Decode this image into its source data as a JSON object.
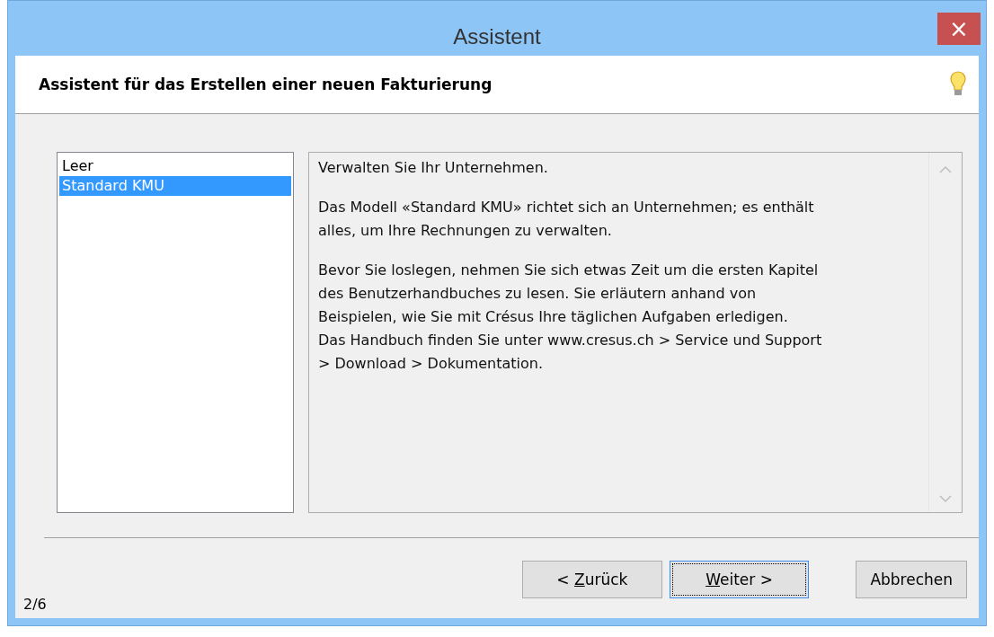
{
  "window": {
    "title": "Assistent",
    "close": "×"
  },
  "header": {
    "title": "Assistent für das Erstellen einer neuen Fakturierung"
  },
  "models": [
    {
      "label": "Leer",
      "selected": false
    },
    {
      "label": "Standard KMU",
      "selected": true
    }
  ],
  "description": [
    "Verwalten Sie Ihr Unternehmen.",
    "Das Modell «Standard KMU» richtet sich an Unternehmen; es enthält\nalles, um Ihre Rechnungen zu verwalten.",
    "Bevor Sie loslegen, nehmen Sie sich etwas Zeit um die ersten Kapitel\ndes Benutzerhandbuches zu lesen. Sie erläutern anhand von\nBeispielen, wie Sie mit Crésus Ihre täglichen Aufgaben erledigen.\nDas Handbuch finden Sie unter www.cresus.ch > Service und Support\n> Download > Dokumentation."
  ],
  "buttons": [
    {
      "before": "< ",
      "mnemonic": "Z",
      "after": "urück",
      "focused": false
    },
    {
      "mnemonic": "W",
      "after": "eiter >",
      "focused": true
    },
    {
      "after": "Abbrechen",
      "focused": false
    }
  ],
  "step": "2/6"
}
